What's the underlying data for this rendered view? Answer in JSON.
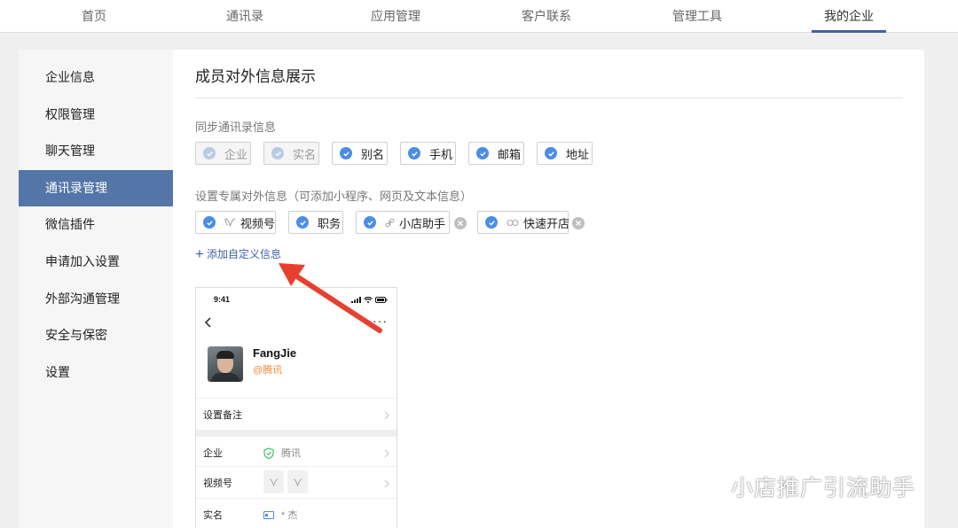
{
  "nav": {
    "tabs": [
      {
        "label": "首页",
        "active": false
      },
      {
        "label": "通讯录",
        "active": false
      },
      {
        "label": "应用管理",
        "active": false
      },
      {
        "label": "客户联系",
        "active": false
      },
      {
        "label": "管理工具",
        "active": false
      },
      {
        "label": "我的企业",
        "active": true
      }
    ]
  },
  "sidebar": {
    "items": [
      {
        "label": "企业信息",
        "active": false
      },
      {
        "label": "权限管理",
        "active": false
      },
      {
        "label": "聊天管理",
        "active": false
      },
      {
        "label": "通讯录管理",
        "active": true
      },
      {
        "label": "微信插件",
        "active": false
      },
      {
        "label": "申请加入设置",
        "active": false
      },
      {
        "label": "外部沟通管理",
        "active": false
      },
      {
        "label": "安全与保密",
        "active": false
      },
      {
        "label": "设置",
        "active": false
      }
    ]
  },
  "main": {
    "title": "成员对外信息展示",
    "sync_label": "同步通讯录信息",
    "sync_chips": [
      {
        "label": "企业",
        "checked": true,
        "disabled": true
      },
      {
        "label": "实名",
        "checked": true,
        "disabled": true
      },
      {
        "label": "别名",
        "checked": true,
        "disabled": false
      },
      {
        "label": "手机",
        "checked": true,
        "disabled": false
      },
      {
        "label": "邮箱",
        "checked": true,
        "disabled": false
      },
      {
        "label": "地址",
        "checked": true,
        "disabled": false
      }
    ],
    "custom_label": "设置专属对外信息（可添加小程序、网页及文本信息）",
    "custom_chips": [
      {
        "label": "视频号",
        "icon": "channels-icon",
        "removable": false
      },
      {
        "label": "职务",
        "icon": "",
        "removable": false
      },
      {
        "label": "小店助手",
        "icon": "mini-program-icon",
        "removable": true
      },
      {
        "label": "快速开店",
        "icon": "link-icon",
        "removable": true
      }
    ],
    "add_link": "添加自定义信息"
  },
  "preview": {
    "time": "9:41",
    "name": "FangJie",
    "org": "@腾讯",
    "remark_label": "设置备注",
    "rows": [
      {
        "label": "企业",
        "value": "腾讯"
      },
      {
        "label": "视频号",
        "value": ""
      },
      {
        "label": "实名",
        "value": "* 杰"
      }
    ]
  },
  "watermark": "小店推广引流助手",
  "colors": {
    "accent": "#3f62a3",
    "sidebar_active": "#5475a7",
    "check": "#4b8de6",
    "arrow": "#e8402f",
    "org": "#f08a3c"
  }
}
